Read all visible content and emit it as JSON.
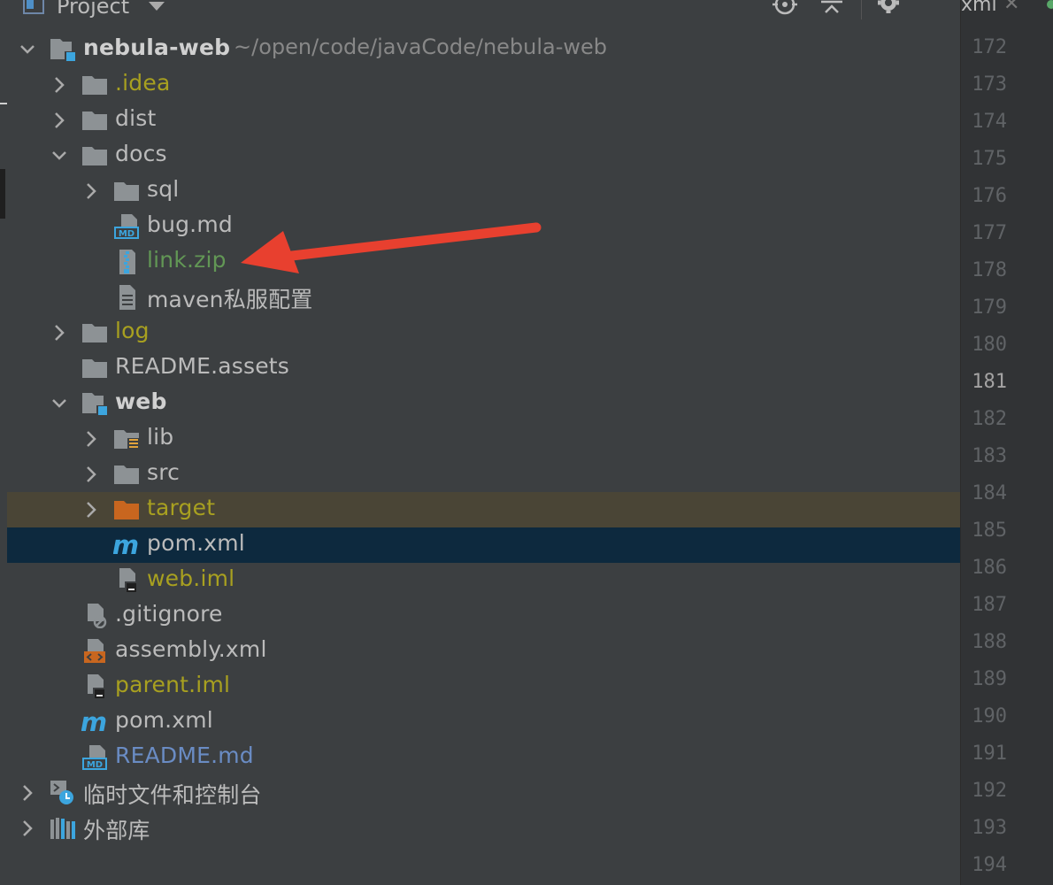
{
  "toolbar": {
    "title": "Project",
    "tab_label": "xml",
    "tab_close": "✕"
  },
  "tree": [
    {
      "depth": 0,
      "expand": "open",
      "icon": "module-folder-icon",
      "label": "nebula-web",
      "style": "bold",
      "sub": "~/open/code/javaCode/nebula-web"
    },
    {
      "depth": 1,
      "expand": "closed",
      "icon": "folder-icon",
      "label": ".idea",
      "style": "olive"
    },
    {
      "depth": 1,
      "expand": "closed",
      "icon": "folder-icon",
      "label": "dist",
      "style": "dim"
    },
    {
      "depth": 1,
      "expand": "open",
      "icon": "folder-icon",
      "label": "docs",
      "style": "dim"
    },
    {
      "depth": 2,
      "expand": "closed",
      "icon": "folder-icon",
      "label": "sql",
      "style": "dim"
    },
    {
      "depth": 2,
      "expand": "none",
      "icon": "markdown-file-icon",
      "label": "bug.md",
      "style": "dim"
    },
    {
      "depth": 2,
      "expand": "none",
      "icon": "zip-file-icon",
      "label": "link.zip",
      "style": "green"
    },
    {
      "depth": 2,
      "expand": "none",
      "icon": "text-file-icon",
      "label": "maven私服配置",
      "style": "dim"
    },
    {
      "depth": 1,
      "expand": "closed",
      "icon": "folder-icon",
      "label": "log",
      "style": "olive"
    },
    {
      "depth": 1,
      "expand": "none",
      "icon": "folder-icon",
      "label": "README.assets",
      "style": "dim"
    },
    {
      "depth": 1,
      "expand": "open",
      "icon": "module-folder-icon",
      "label": "web",
      "style": "bold"
    },
    {
      "depth": 2,
      "expand": "closed",
      "icon": "library-folder-icon",
      "label": "lib",
      "style": "dim"
    },
    {
      "depth": 2,
      "expand": "closed",
      "icon": "folder-icon",
      "label": "src",
      "style": "dim"
    },
    {
      "depth": 2,
      "expand": "closed",
      "icon": "excluded-folder-icon",
      "label": "target",
      "style": "olive",
      "row": "hl-target"
    },
    {
      "depth": 2,
      "expand": "none",
      "icon": "maven-icon",
      "label": "pom.xml",
      "style": "dim",
      "row": "selected"
    },
    {
      "depth": 2,
      "expand": "none",
      "icon": "iml-file-icon",
      "label": "web.iml",
      "style": "olive"
    },
    {
      "depth": 1,
      "expand": "none",
      "icon": "gitignore-file-icon",
      "label": ".gitignore",
      "style": "dim"
    },
    {
      "depth": 1,
      "expand": "none",
      "icon": "xml-file-icon",
      "label": "assembly.xml",
      "style": "dim"
    },
    {
      "depth": 1,
      "expand": "none",
      "icon": "iml-file-icon",
      "label": "parent.iml",
      "style": "olive"
    },
    {
      "depth": 1,
      "expand": "none",
      "icon": "maven-icon",
      "label": "pom.xml",
      "style": "dim"
    },
    {
      "depth": 1,
      "expand": "none",
      "icon": "markdown-file-icon",
      "label": "README.md",
      "style": "blue"
    },
    {
      "depth": 0,
      "expand": "closed",
      "icon": "scratches-icon",
      "label": "临时文件和控制台",
      "style": "dim"
    },
    {
      "depth": 0,
      "expand": "closed",
      "icon": "external-libraries-icon",
      "label": "外部库",
      "style": "dim"
    }
  ],
  "gutter": {
    "current_line": "181",
    "lines": [
      "172",
      "173",
      "174",
      "175",
      "176",
      "177",
      "178",
      "179",
      "180",
      "181",
      "182",
      "183",
      "184",
      "185",
      "186",
      "187",
      "188",
      "189",
      "190",
      "191",
      "192",
      "193",
      "194"
    ]
  },
  "colors": {
    "background": "#3c3f41",
    "selected_row": "#0d293e",
    "excluded_row": "#4a4536",
    "annotation_arrow": "#e8402f"
  }
}
